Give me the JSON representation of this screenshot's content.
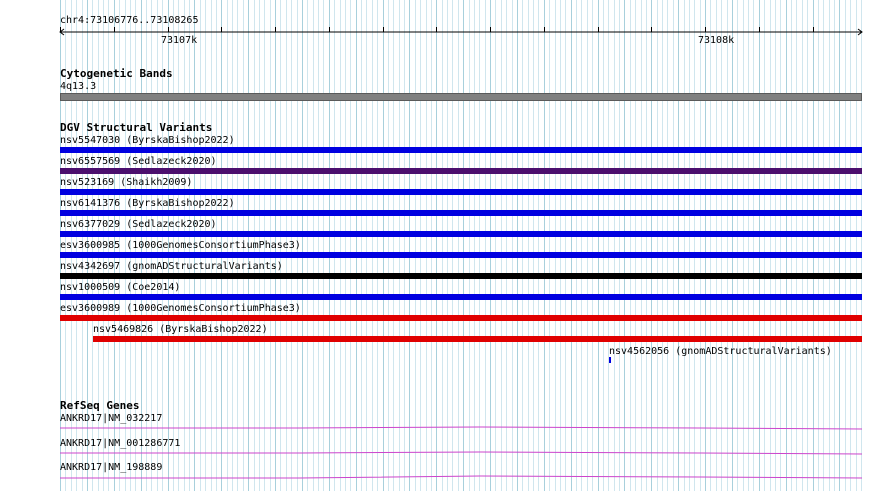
{
  "location": "chr4:73106776..73108265",
  "ruler": {
    "ticks": [
      "73107k",
      "73108k"
    ]
  },
  "tracks": [
    {
      "name": "Cytogenetic Bands",
      "features": [
        {
          "label": "4q13.3",
          "color": "#808080"
        }
      ]
    },
    {
      "name": "DGV Structural Variants",
      "features": [
        {
          "label": "nsv5547030 (ByrskaBishop2022)",
          "color": "#0000e0"
        },
        {
          "label": "nsv6557569 (Sedlazeck2020)",
          "color": "#4b0f6e"
        },
        {
          "label": "nsv523169 (Shaikh2009)",
          "color": "#0000e0"
        },
        {
          "label": "nsv6141376 (ByrskaBishop2022)",
          "color": "#0000e0"
        },
        {
          "label": "nsv6377029 (Sedlazeck2020)",
          "color": "#0000e0"
        },
        {
          "label": "esv3600985 (1000GenomesConsortiumPhase3)",
          "color": "#0000e0"
        },
        {
          "label": "nsv4342697 (gnomADStructuralVariants)",
          "color": "#000000"
        },
        {
          "label": "nsv1000509 (Coe2014)",
          "color": "#0000e0"
        },
        {
          "label": "esv3600989 (1000GenomesConsortiumPhase3)",
          "color": "#e00000"
        },
        {
          "label": "nsv5469826 (ByrskaBishop2022)",
          "color": "#e00000"
        },
        {
          "label": "nsv4562056 (gnomADStructuralVariants)",
          "color": "#0000e0"
        }
      ]
    },
    {
      "name": "RefSeq Genes",
      "features": [
        {
          "label": "ANKRD17|NM_032217",
          "color": "#cc44cc"
        },
        {
          "label": "ANKRD17|NM_001286771",
          "color": "#cc44cc"
        },
        {
          "label": "ANKRD17|NM_198889",
          "color": "#cc44cc"
        }
      ]
    }
  ]
}
